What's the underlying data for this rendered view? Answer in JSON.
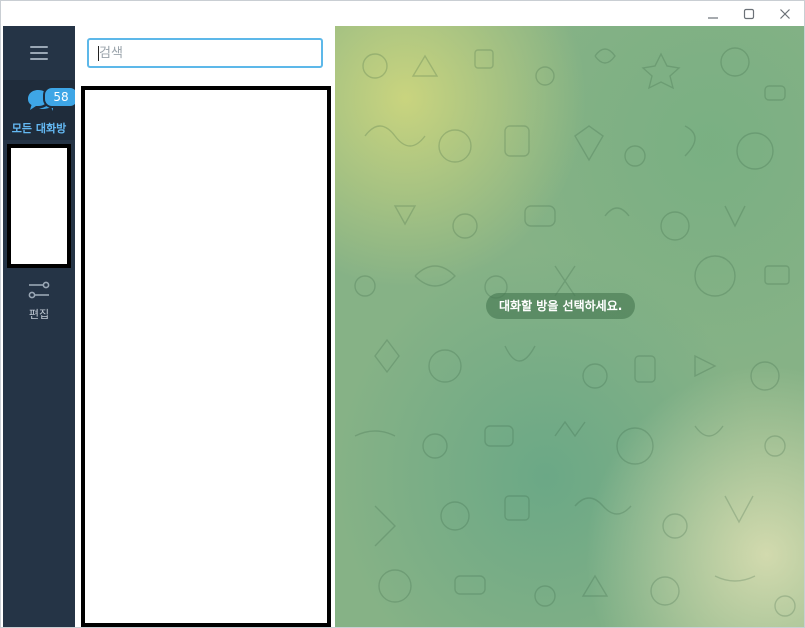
{
  "window": {
    "controls": {
      "minimize_icon": "minimize-icon",
      "maximize_icon": "maximize-icon",
      "close_icon": "close-icon"
    }
  },
  "sidebar": {
    "menu_icon": "hamburger-menu-icon",
    "folder_all": {
      "label": "모든 대화방",
      "unread_count": "58",
      "icon": "chat-bubbles-icon"
    },
    "edit": {
      "label": "편집",
      "icon": "sliders-icon"
    }
  },
  "chat_list": {
    "search": {
      "placeholder": "검색",
      "value": ""
    }
  },
  "chat_area": {
    "empty_message": "대화할 방을 선택하세요."
  },
  "colors": {
    "sidebar_bg": "#253446",
    "accent": "#3ea6e6",
    "active_label": "#64b9f3"
  }
}
